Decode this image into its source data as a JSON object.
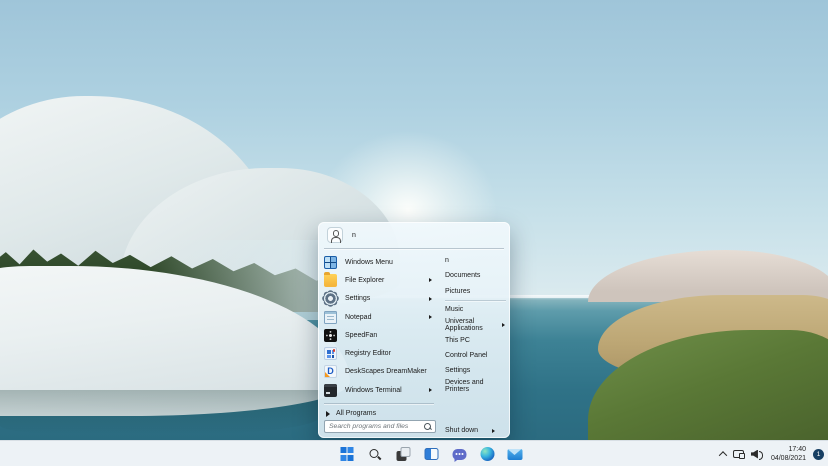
{
  "start_menu": {
    "user_name": "n",
    "left_items": [
      {
        "label": "Windows Menu",
        "has_submenu": false
      },
      {
        "label": "File Explorer",
        "has_submenu": true
      },
      {
        "label": "Settings",
        "has_submenu": true
      },
      {
        "label": "Notepad",
        "has_submenu": true
      },
      {
        "label": "SpeedFan",
        "has_submenu": false
      },
      {
        "label": "Registry Editor",
        "has_submenu": false
      },
      {
        "label": "DeskScapes DreamMaker",
        "has_submenu": false
      },
      {
        "label": "Windows Terminal",
        "has_submenu": true
      }
    ],
    "all_programs_label": "All Programs",
    "search_placeholder": "Search programs and files",
    "right_items": [
      {
        "label": "n"
      },
      {
        "label": "Documents"
      },
      {
        "label": "Pictures"
      },
      {
        "label": "Music"
      },
      {
        "label": "Universal Applications",
        "has_submenu": true
      },
      {
        "label": "This PC"
      },
      {
        "label": "Control Panel"
      },
      {
        "label": "Settings"
      },
      {
        "label": "Devices and Printers"
      }
    ],
    "shutdown_label": "Shut down"
  },
  "taskbar": {
    "buttons": [
      "start",
      "search",
      "task-view",
      "widgets",
      "chat",
      "edge",
      "mail"
    ],
    "tray": {
      "time": "17:40",
      "date": "04/08/2021",
      "notification_count": "1"
    }
  },
  "colors": {
    "accent_blue": "#1b74d8",
    "water_teal": "#2e7085",
    "taskbar_bg": "#edf2f6"
  }
}
